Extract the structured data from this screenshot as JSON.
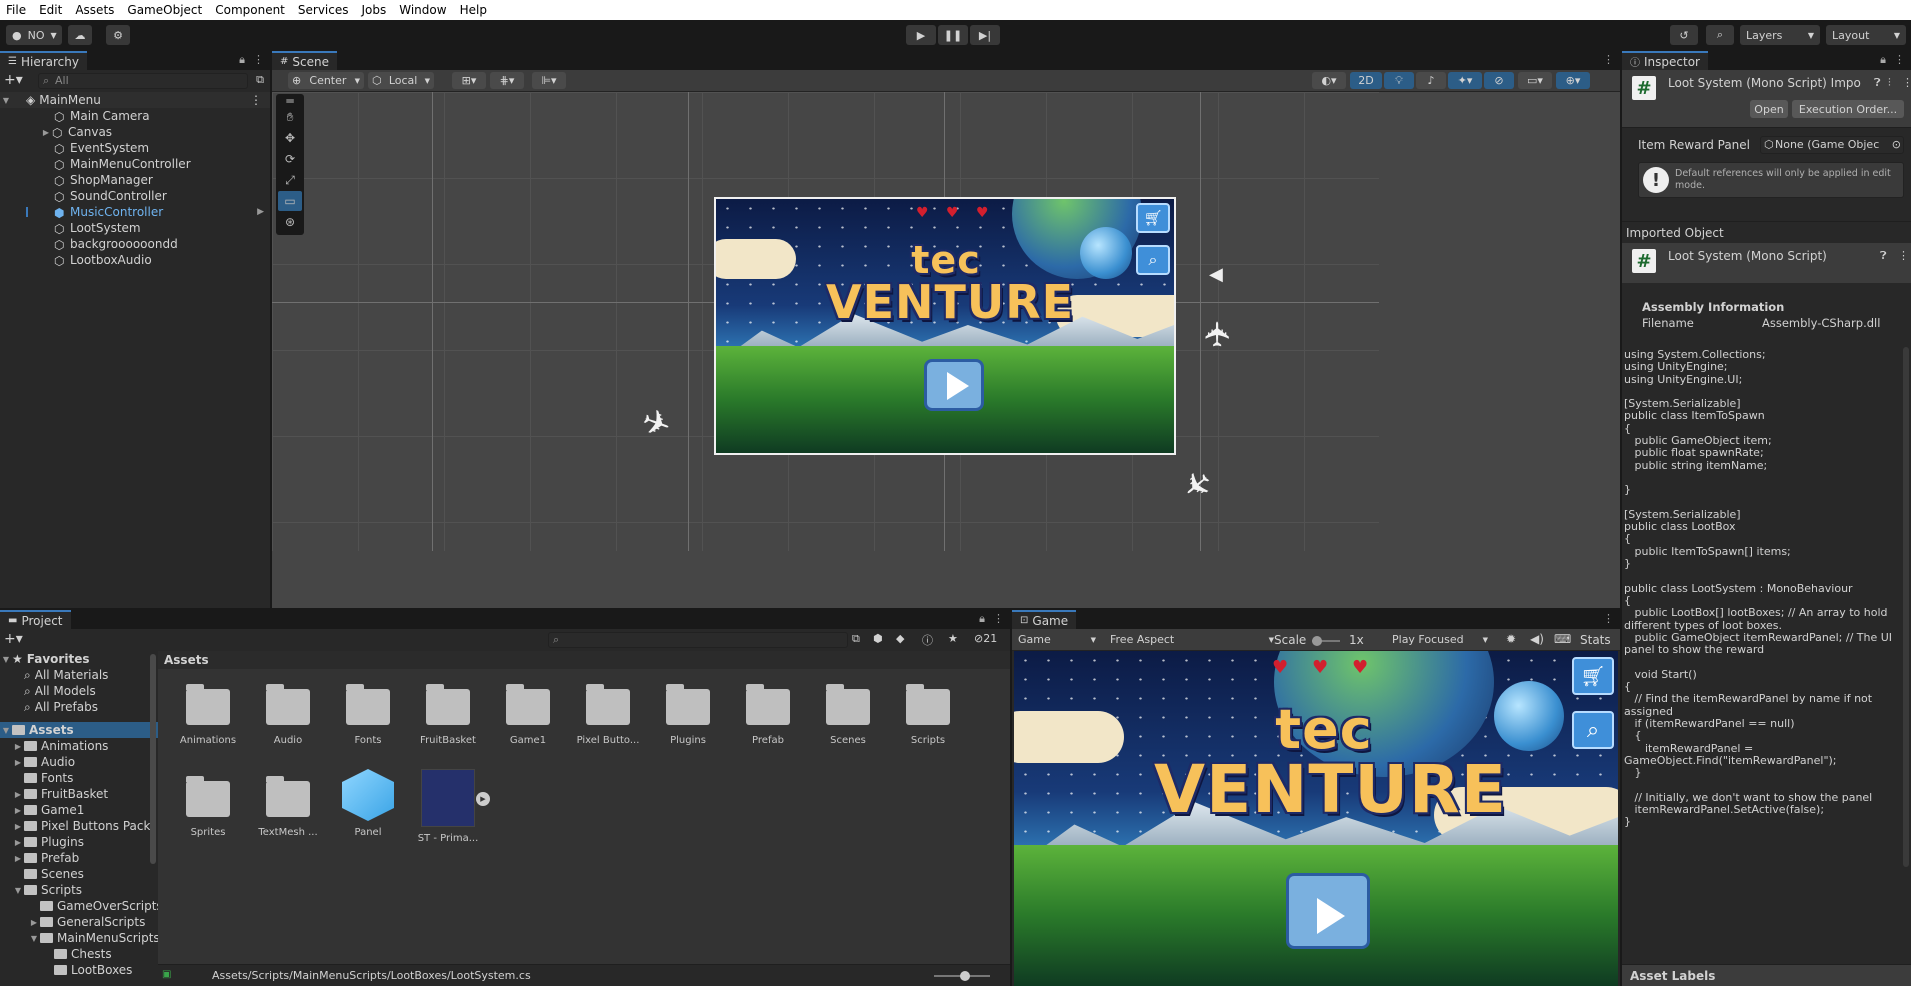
{
  "menu": [
    "File",
    "Edit",
    "Assets",
    "GameObject",
    "Component",
    "Services",
    "Jobs",
    "Window",
    "Help"
  ],
  "toolbar": {
    "account": "NO",
    "layers": "Layers",
    "layout": "Layout"
  },
  "hierarchy": {
    "tab": "Hierarchy",
    "search_placeholder": "All",
    "scene": "MainMenu",
    "items": [
      "Main Camera",
      "Canvas",
      "EventSystem",
      "MainMenuController",
      "ShopManager",
      "SoundController",
      "MusicController",
      "LootSystem",
      "backgroooooondd",
      "LootboxAudio"
    ],
    "selected": "MusicController"
  },
  "scene": {
    "tab": "Scene",
    "pivot": "Center",
    "space": "Local",
    "mode2d": "2D"
  },
  "art": {
    "logo_line1": "tec",
    "logo_line2": "VENTURE"
  },
  "inspector": {
    "tab": "Inspector",
    "title": "Loot System (Mono Script) Impo",
    "open": "Open",
    "exec_order": "Execution Order...",
    "field_label": "Item Reward Panel",
    "field_value": "None (Game Objec",
    "info": "Default references will only be applied in edit mode.",
    "imported_header": "Imported Object",
    "imported_title": "Loot System (Mono Script)",
    "assembly_header": "Assembly Information",
    "filename_label": "Filename",
    "filename_value": "Assembly-CSharp.dll",
    "code": "using System.Collections;\nusing UnityEngine;\nusing UnityEngine.UI;\n\n[System.Serializable]\npublic class ItemToSpawn\n{\n   public GameObject item;\n   public float spawnRate;\n   public string itemName;\n\n}\n\n[System.Serializable]\npublic class LootBox\n{\n   public ItemToSpawn[] items;\n}\n\npublic class LootSystem : MonoBehaviour\n{\n   public LootBox[] lootBoxes; // An array to hold different types of loot boxes.\n   public GameObject itemRewardPanel; // The UI panel to show the reward\n\n   void Start()\n{\n   // Find the itemRewardPanel by name if not assigned\n   if (itemRewardPanel == null)\n   {\n      itemRewardPanel = GameObject.Find(\"itemRewardPanel\");\n   }\n\n   // Initially, we don't want to show the panel\n   itemRewardPanel.SetActive(false);\n}",
    "asset_labels": "Asset Labels"
  },
  "project": {
    "tab": "Project",
    "favorites": "Favorites",
    "fav_items": [
      "All Materials",
      "All Models",
      "All Prefabs"
    ],
    "assets_root": "Assets",
    "tree": [
      "Animations",
      "Audio",
      "Fonts",
      "FruitBasket",
      "Game1",
      "Pixel Buttons Pack",
      "Plugins",
      "Prefab",
      "Scenes",
      "Scripts"
    ],
    "scripts_children": [
      "GameOverScripts",
      "GeneralScripts",
      "MainMenuScripts"
    ],
    "mainmenu_children": [
      "Chests",
      "LootBoxes"
    ],
    "breadcrumb": "Assets",
    "hidden_count": "21",
    "grid_row1": [
      "Animations",
      "Audio",
      "Fonts",
      "FruitBasket",
      "Game1",
      "Pixel Butto...",
      "Plugins",
      "Prefab",
      "Scenes",
      "Scripts"
    ],
    "grid_row2": [
      "Sprites",
      "TextMesh ...",
      "Panel",
      "ST - Prima..."
    ],
    "path": "Assets/Scripts/MainMenuScripts/LootBoxes/LootSystem.cs"
  },
  "game": {
    "tab": "Game",
    "display": "Game",
    "aspect": "Free Aspect",
    "scale_label": "Scale",
    "scale_value": "1x",
    "play_mode": "Play Focused",
    "stats": "Stats"
  },
  "colors": {
    "accent": "#3a79bb",
    "selected_row": "#2c5d87",
    "panel": "#282828",
    "scene_bg": "#464646"
  }
}
